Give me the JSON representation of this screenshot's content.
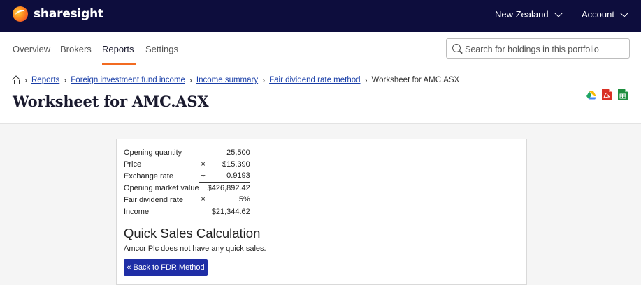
{
  "app": {
    "brand": "sharesight",
    "region": "New Zealand",
    "account": "Account"
  },
  "nav": {
    "tabs": [
      {
        "label": "Overview"
      },
      {
        "label": "Brokers"
      },
      {
        "label": "Reports",
        "active": true
      },
      {
        "label": "Settings"
      }
    ],
    "search_placeholder": "Search for holdings in this portfolio",
    "accent_color": "#f26b21"
  },
  "breadcrumb": {
    "items": [
      "Reports",
      "Foreign investment fund income",
      "Income summary",
      "Fair dividend rate method"
    ],
    "current": "Worksheet for AMC.ASX"
  },
  "page": {
    "title": "Worksheet for AMC.ASX",
    "export_icons": [
      "google-drive-icon",
      "pdf-icon",
      "spreadsheet-icon"
    ]
  },
  "worksheet": {
    "rows": [
      {
        "label": "Opening quantity",
        "op": "",
        "value": "25,500"
      },
      {
        "label": "Price",
        "op": "×",
        "value": "$15.390"
      },
      {
        "label": "Exchange rate",
        "op": "÷",
        "value": "0.9193"
      },
      {
        "label": "Opening market value",
        "op": "",
        "value": "$426,892.42"
      },
      {
        "label": "Fair dividend rate",
        "op": "×",
        "value": "5%"
      },
      {
        "label": "Income",
        "op": "",
        "value": "$21,344.62"
      }
    ]
  },
  "quick_sales": {
    "title": "Quick Sales Calculation",
    "text": "Amcor Plc does not have any quick sales.",
    "back_button": "« Back to FDR Method"
  },
  "colors": {
    "topbar": "#0d0d3d",
    "link": "#1a3fa8",
    "button": "#1f2ea6"
  }
}
